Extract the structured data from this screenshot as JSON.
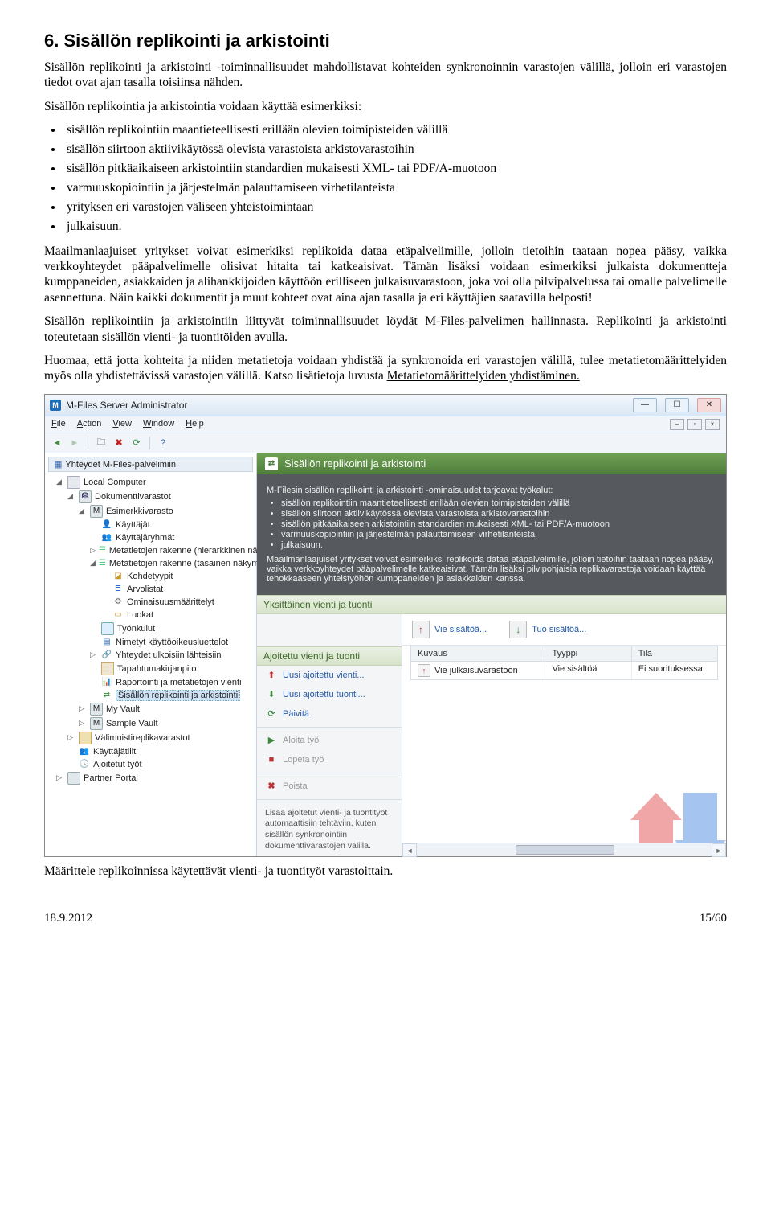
{
  "heading": "6. Sisällön replikointi ja arkistointi",
  "para1": "Sisällön replikointi ja arkistointi -toiminnallisuudet mahdollistavat kohteiden synkronoinnin varastojen välillä, jolloin eri varastojen tiedot ovat ajan tasalla toisiinsa nähden.",
  "para2": "Sisällön replikointia ja arkistointia voidaan käyttää esimerkiksi:",
  "bullets": [
    "sisällön replikointiin maantieteellisesti erillään olevien toimipisteiden välillä",
    "sisällön siirtoon aktiivikäytössä olevista varastoista arkistovarastoihin",
    "sisällön pitkäaikaiseen arkistointiin standardien mukaisesti XML- tai PDF/A-muotoon",
    "varmuuskopiointiin ja järjestelmän palauttamiseen virhetilanteista",
    "yrityksen eri varastojen väliseen yhteistoimintaan",
    "julkaisuun."
  ],
  "para3": "Maailmanlaajuiset yritykset voivat esimerkiksi replikoida dataa etäpalvelimille, jolloin tietoihin taataan nopea pääsy, vaikka verkkoyhteydet pääpalvelimelle olisivat hitaita tai katkeaisivat. Tämän lisäksi voidaan esimerkiksi julkaista dokumentteja kumppaneiden, asiakkaiden ja alihankkijoiden käyttöön erilliseen julkaisuvarastoon, joka voi olla pilvipalvelussa tai omalle palvelimelle asennettuna. Näin kaikki dokumentit ja muut kohteet ovat aina ajan tasalla ja eri käyttäjien saatavilla helposti!",
  "para4a": "Sisällön replikointiin ja arkistointiin liittyvät toiminnallisuudet löydät M-Files-palvelimen ",
  "para4b": "hallinnasta",
  "para4c": ". Replikointi ja arkistointi toteutetaan sisällön vienti- ja tuontitöiden avulla.",
  "para5a": "Huomaa, että jotta kohteita ja niiden metatietoja voidaan yhdistää ja synkronoida eri varastojen välillä, tulee metatietomäärittelyiden myös olla yhdistettävissä varastojen välillä. Katso lisätietoja luvusta ",
  "para5b": "Metatietomäärittelyiden yhdistäminen.",
  "caption_bottom": "Määrittele replikoinnissa käytettävät vienti- ja tuontityöt varastoittain.",
  "footer_date": "18.9.2012",
  "footer_page": "15/60",
  "app": {
    "title": "M-Files Server Administrator",
    "menu": {
      "file": "File",
      "action": "Action",
      "view": "View",
      "window": "Window",
      "help": "Help"
    },
    "tree_header": "Yhteydet M-Files-palvelimiin",
    "tree": {
      "root": "Local Computer",
      "docvaults": "Dokumenttivarastot",
      "vault": "Esimerkkivarasto",
      "items": [
        "Käyttäjät",
        "Käyttäjäryhmät",
        "Metatietojen rakenne (hierarkkinen näkymä)",
        "Metatietojen rakenne (tasainen näkymä)",
        "Kohdetyypit",
        "Arvolistat",
        "Ominaisuusmäärittelyt",
        "Luokat",
        "Työnkulut",
        "Nimetyt käyttöoikeusluettelot",
        "Yhteydet ulkoisiin lähteisiin",
        "Tapahtumakirjanpito",
        "Raportointi ja metatietojen vienti",
        "Sisällön replikointi ja arkistointi"
      ],
      "myvault": "My Vault",
      "samplevault": "Sample Vault",
      "cache": "Välimuistireplikavarastot",
      "accounts": "Käyttäjätilit",
      "scheduled": "Ajoitetut työt",
      "partner": "Partner Portal"
    },
    "content": {
      "header": "Sisällön replikointi ja arkistointi",
      "intro": "M-Filesin sisällön replikointi ja arkistointi -ominaisuudet tarjoavat työkalut:",
      "panel_bullets": [
        "sisällön replikointiin maantieteellisesti erillään olevien toimipisteiden välillä",
        "sisällön siirtoon aktiivikäytössä olevista varastoista arkistovarastoihin",
        "sisällön pitkäaikaiseen arkistointiin standardien mukaisesti XML- tai PDF/A-muotoon",
        "varmuuskopiointiin ja järjestelmän palauttamiseen virhetilanteista",
        "julkaisuun."
      ],
      "panel_p2": "Maailmanlaajuiset yritykset voivat esimerkiksi replikoida dataa etäpalvelimille, jolloin tietoihin taataan nopea pääsy, vaikka verkkoyhteydet pääpalvelimelle katkeaisivat. Tämän lisäksi pilvipohjaisia replikavarastoja voidaan käyttää tehokkaaseen yhteistyöhön kumppaneiden ja asiakkaiden kanssa.",
      "single_title": "Yksittäinen vienti ja tuonti",
      "export_btn": "Vie sisältöä...",
      "import_btn": "Tuo sisältöä...",
      "sched_title": "Ajoitettu vienti ja tuonti",
      "new_export": "Uusi ajoitettu vienti...",
      "new_import": "Uusi ajoitettu tuonti...",
      "refresh": "Päivitä",
      "start": "Aloita työ",
      "stop": "Lopeta työ",
      "delete": "Poista",
      "note": "Lisää ajoitetut vienti- ja tuontityöt automaattisiin tehtäviin, kuten sisällön synkronointiin dokumenttivarastojen välillä.",
      "th1": "Kuvaus",
      "th2": "Tyyppi",
      "th3": "Tila",
      "row_desc": "Vie julkaisuvarastoon",
      "row_type": "Vie sisältöä",
      "row_state": "Ei suorituksessa"
    }
  }
}
